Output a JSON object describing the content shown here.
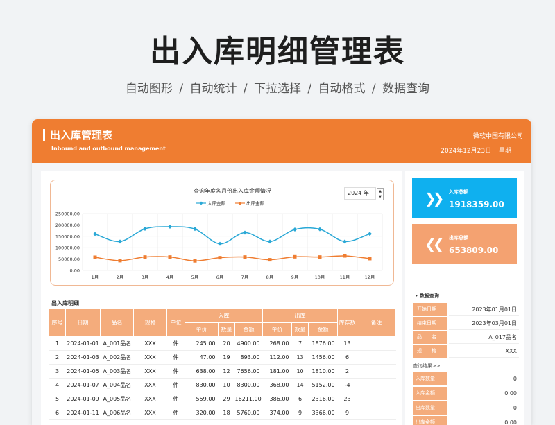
{
  "page_title": "出入库明细管理表",
  "subtitle": "自动图形 / 自动统计 / 下拉选择  / 自动格式 / 数据查询",
  "banner": {
    "title": "出入库管理表",
    "subtitle_en": "Inbound and outbound management",
    "company": "微软中国有限公司",
    "date": "2024年12月23日",
    "weekday": "星期一"
  },
  "colors": {
    "accent": "#ef7d31",
    "header_light": "#f4ac7c",
    "inbound_line": "#29a8d6",
    "outbound_line": "#ef7d31",
    "kpi_in": "#0fb0ef",
    "kpi_out": "#f4a271"
  },
  "year_selector": {
    "value": "2024 年",
    "spin_up": "▲",
    "spin_down": "▼"
  },
  "chart_data": {
    "type": "line",
    "title": "查询年度各月份出入库金额情况",
    "categories": [
      "1月",
      "2月",
      "3月",
      "4月",
      "5月",
      "6月",
      "7月",
      "8月",
      "9月",
      "10月",
      "11月",
      "12月"
    ],
    "y_tick_labels": [
      "0.00",
      "50000.00",
      "100000.00",
      "150000.00",
      "200000.00",
      "250000.00"
    ],
    "ylim": [
      0,
      250000
    ],
    "grid": true,
    "legend_position": "top-center",
    "series": [
      {
        "name": "入库金额",
        "color": "#29a8d6",
        "marker": "diamond",
        "values": [
          160000,
          127000,
          183000,
          192000,
          182000,
          117000,
          166000,
          127000,
          180000,
          181000,
          127000,
          161000
        ]
      },
      {
        "name": "出库金额",
        "color": "#ef7d31",
        "marker": "square",
        "values": [
          58000,
          43000,
          59000,
          59000,
          42000,
          56000,
          59000,
          47000,
          60000,
          59000,
          64000,
          52000
        ]
      }
    ]
  },
  "detail": {
    "title": "出入库明细",
    "headers": {
      "seq": "序号",
      "date": "日期",
      "name": "品名",
      "spec": "规格",
      "unit": "单位",
      "in_group": "入库",
      "out_group": "出库",
      "stock": "库存数",
      "remark": "备注",
      "price": "单价",
      "qty": "数量",
      "amount": "金额"
    },
    "rows": [
      [
        "1",
        "2024-01-01",
        "A_001品名",
        "XXX",
        "件",
        "245.00",
        "20",
        "4900.00",
        "268.00",
        "7",
        "1876.00",
        "13",
        ""
      ],
      [
        "2",
        "2024-01-03",
        "A_002品名",
        "XXX",
        "件",
        "47.00",
        "19",
        "893.00",
        "112.00",
        "13",
        "1456.00",
        "6",
        ""
      ],
      [
        "3",
        "2024-01-05",
        "A_003品名",
        "XXX",
        "件",
        "638.00",
        "12",
        "7656.00",
        "181.00",
        "10",
        "1810.00",
        "2",
        ""
      ],
      [
        "4",
        "2024-01-07",
        "A_004品名",
        "XXX",
        "件",
        "830.00",
        "10",
        "8300.00",
        "368.00",
        "14",
        "5152.00",
        "-4",
        ""
      ],
      [
        "5",
        "2024-01-09",
        "A_005品名",
        "XXX",
        "件",
        "559.00",
        "29",
        "16211.00",
        "386.00",
        "6",
        "2316.00",
        "23",
        ""
      ],
      [
        "6",
        "2024-01-11",
        "A_006品名",
        "XXX",
        "件",
        "320.00",
        "18",
        "5760.00",
        "374.00",
        "9",
        "3366.00",
        "9",
        ""
      ]
    ]
  },
  "kpi": {
    "inbound": {
      "label": "入库总额",
      "value": "1918359.00",
      "icon": "chevron-right-double-icon"
    },
    "outbound": {
      "label": "出库总额",
      "value": "653809.00",
      "icon": "chevron-left-double-icon"
    }
  },
  "query": {
    "title": "• 数据查询",
    "fields": [
      {
        "label": "开始日期",
        "value": "2023年01月01日"
      },
      {
        "label": "结束日期",
        "value": "2023年03月01日"
      },
      {
        "label": "品　　名",
        "value": "A_017品名"
      },
      {
        "label": "规　　格",
        "value": "XXX"
      }
    ],
    "result_link": "查询结果>>",
    "results": [
      {
        "label": "入库数量",
        "value": "0"
      },
      {
        "label": "入库金额",
        "value": "0.00"
      },
      {
        "label": "出库数量",
        "value": "0"
      },
      {
        "label": "出库金额",
        "value": "0.00"
      }
    ]
  }
}
